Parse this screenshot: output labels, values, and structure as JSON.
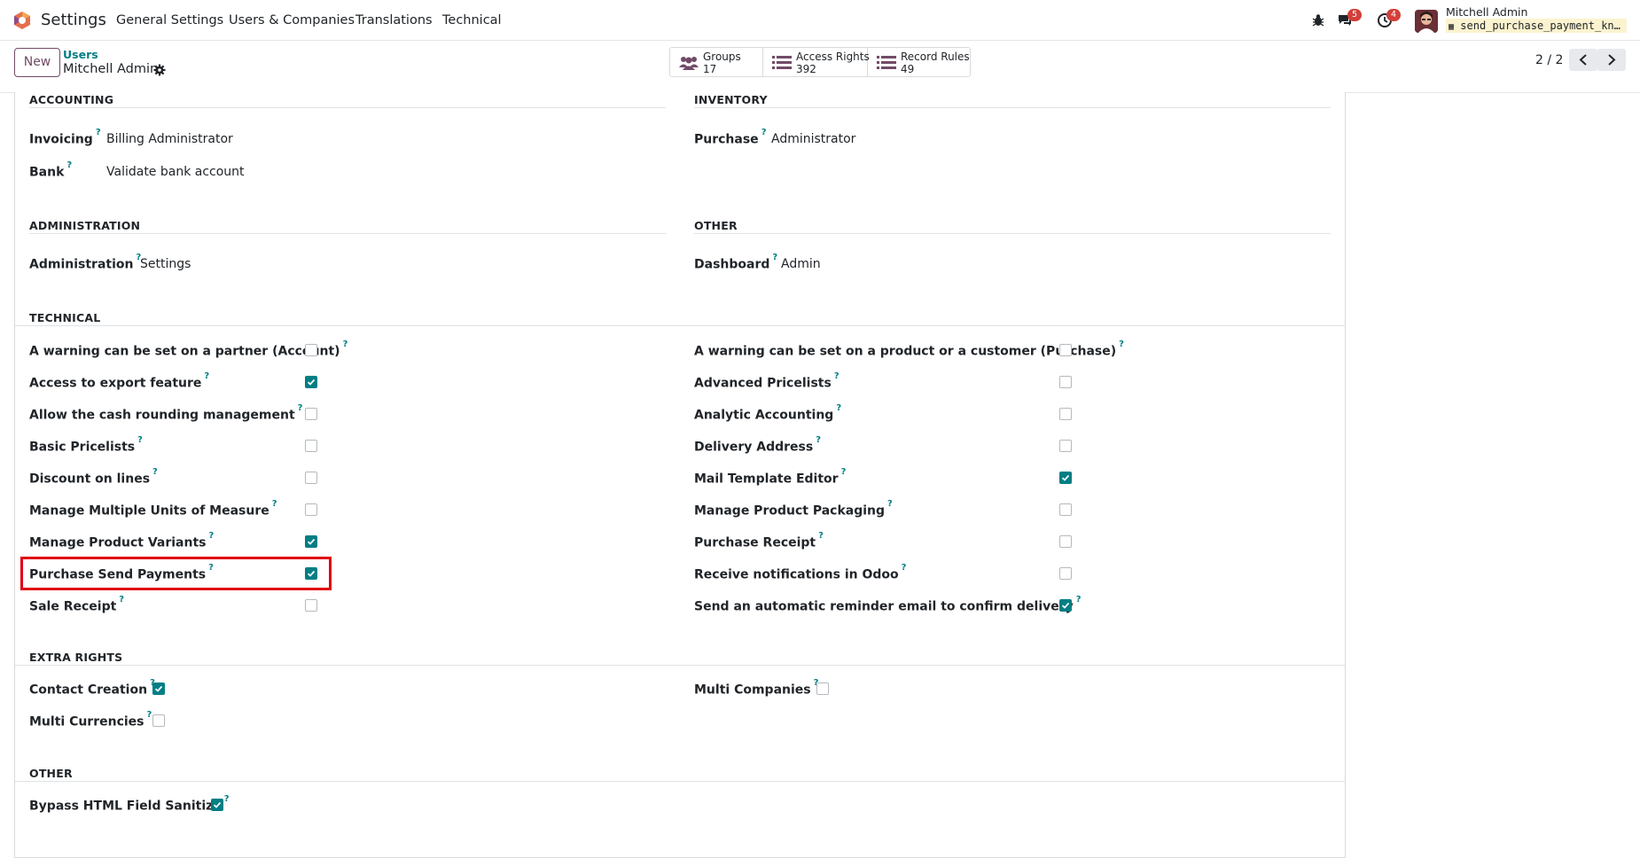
{
  "navbar": {
    "app_title": "Settings",
    "menu": [
      "General Settings",
      "Users & Companies",
      "Translations",
      "Technical"
    ],
    "messages_badge": "5",
    "activities_badge": "4",
    "user_name": "Mitchell Admin",
    "db_name": "send_purchase_payment_kn…"
  },
  "control": {
    "new_label": "New",
    "breadcrumb": "Users",
    "record_name": "Mitchell Admin",
    "smart_buttons": [
      {
        "label": "Groups",
        "count": "17",
        "icon": "users-icon"
      },
      {
        "label": "Access Rights",
        "count": "392",
        "icon": "list-icon"
      },
      {
        "label": "Record Rules",
        "count": "49",
        "icon": "list-icon"
      }
    ],
    "pager": "2 / 2"
  },
  "sections": {
    "accounting": {
      "title": "ACCOUNTING",
      "fields": [
        {
          "label": "Invoicing",
          "value": "Billing Administrator"
        },
        {
          "label": "Bank",
          "value": "Validate bank account"
        }
      ]
    },
    "inventory": {
      "title": "INVENTORY",
      "fields": [
        {
          "label": "Purchase",
          "value": "Administrator"
        }
      ]
    },
    "administration": {
      "title": "ADMINISTRATION",
      "fields": [
        {
          "label": "Administration",
          "value": "Settings"
        }
      ]
    },
    "other_apps": {
      "title": "OTHER",
      "fields": [
        {
          "label": "Dashboard",
          "value": "Admin"
        }
      ]
    },
    "technical": {
      "title": "TECHNICAL",
      "left": [
        {
          "label": "A warning can be set on a partner (Account)",
          "checked": false
        },
        {
          "label": "Access to export feature",
          "checked": true
        },
        {
          "label": "Allow the cash rounding management",
          "checked": false
        },
        {
          "label": "Basic Pricelists",
          "checked": false
        },
        {
          "label": "Discount on lines",
          "checked": false
        },
        {
          "label": "Manage Multiple Units of Measure",
          "checked": false
        },
        {
          "label": "Manage Product Variants",
          "checked": true
        },
        {
          "label": "Purchase Send Payments",
          "checked": true
        },
        {
          "label": "Sale Receipt",
          "checked": false
        }
      ],
      "right": [
        {
          "label": "A warning can be set on a product or a customer (Purchase)",
          "checked": false
        },
        {
          "label": "Advanced Pricelists",
          "checked": false
        },
        {
          "label": "Analytic Accounting",
          "checked": false
        },
        {
          "label": "Delivery Address",
          "checked": false
        },
        {
          "label": "Mail Template Editor",
          "checked": true
        },
        {
          "label": "Manage Product Packaging",
          "checked": false
        },
        {
          "label": "Purchase Receipt",
          "checked": false
        },
        {
          "label": "Receive notifications in Odoo",
          "checked": false
        },
        {
          "label": "Send an automatic reminder email to confirm delivery",
          "checked": true
        }
      ]
    },
    "extra_rights": {
      "title": "EXTRA RIGHTS",
      "items": [
        {
          "label": "Contact Creation",
          "checked": true
        },
        {
          "label": "Multi Currencies",
          "checked": false
        },
        {
          "label": "Multi Companies",
          "checked": false
        }
      ]
    },
    "other": {
      "title": "OTHER",
      "items": [
        {
          "label": "Bypass HTML Field Sanitize",
          "checked": true
        }
      ]
    }
  },
  "help_marker": "?",
  "colors": {
    "accent": "#017e84",
    "brand": "#714b67",
    "badge": "#d23f3a",
    "highlight": "#e00012"
  }
}
